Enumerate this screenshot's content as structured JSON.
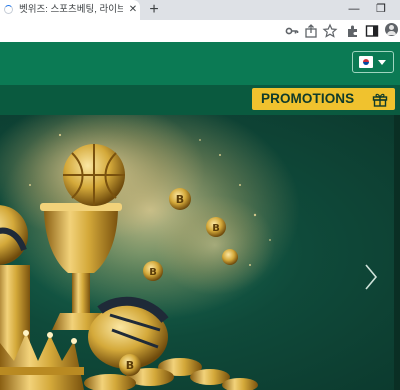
{
  "browser": {
    "tab": {
      "title": "벳위즈: 스포츠베팅, 라이브카지노",
      "close_glyph": "✕"
    },
    "new_tab_glyph": "+",
    "window_controls": {
      "minimize": "—",
      "restore": "❐",
      "close": "✕"
    },
    "toolbar_icons": [
      "key-icon",
      "share-icon",
      "star-icon",
      "extensions-icon",
      "sidebar-icon",
      "profile-icon"
    ]
  },
  "header": {
    "language": {
      "selected_flag": "south-korea-flag-icon"
    }
  },
  "subnav": {
    "promotions_label": "PROMOTIONS"
  },
  "banner": {
    "image": "golden-trophies-crypto-coins-artwork",
    "colors": {
      "background": "#0f4a3a",
      "gold": "#d4a93a"
    }
  },
  "colors": {
    "header_green": "#0b7a54",
    "subnav_green": "#0a5a3f",
    "promo_yellow": "#f0c22e"
  }
}
